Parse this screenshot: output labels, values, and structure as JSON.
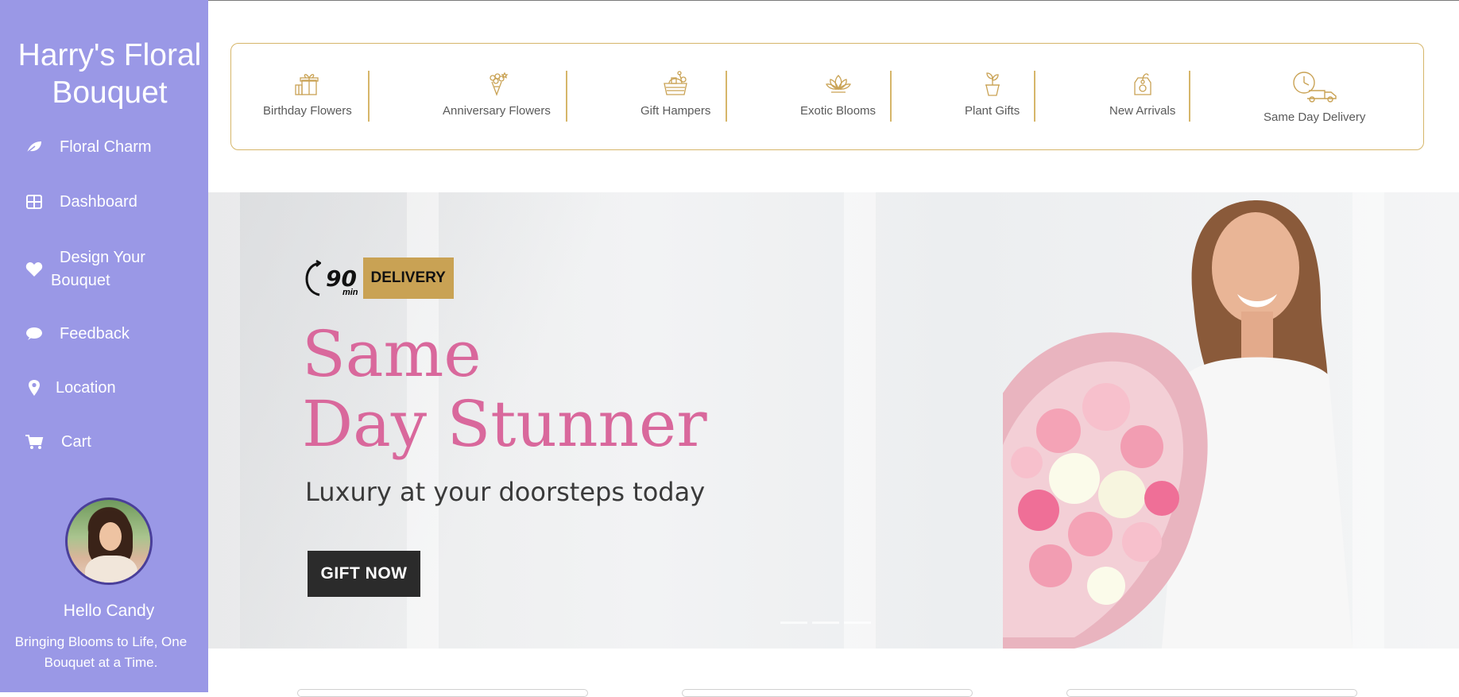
{
  "sidebar": {
    "brand": "Harry's Floral Bouquet",
    "items": [
      {
        "label": "Floral Charm",
        "icon": "leaf-icon"
      },
      {
        "label": "Dashboard",
        "icon": "grid-icon"
      },
      {
        "label": "Design Your Bouquet",
        "icon": "heart-icon"
      },
      {
        "label": "Feedback",
        "icon": "chat-bubble-icon"
      },
      {
        "label": "Location",
        "icon": "map-pin-icon"
      },
      {
        "label": "Cart",
        "icon": "shopping-cart-icon"
      }
    ],
    "greeting": "Hello Candy",
    "tagline": "Bringing Blooms to Life, One Bouquet at a Time."
  },
  "categories": [
    {
      "label": "Birthday Flowers",
      "icon": "gift-box-icon"
    },
    {
      "label": "Anniversary Flowers",
      "icon": "flower-bouquet-icon"
    },
    {
      "label": "Gift Hampers",
      "icon": "hamper-basket-icon"
    },
    {
      "label": "Exotic Blooms",
      "icon": "lotus-icon"
    },
    {
      "label": "Plant Gifts",
      "icon": "potted-plant-icon"
    },
    {
      "label": "New Arrivals",
      "icon": "tag-icon"
    },
    {
      "label": "Same Day Delivery",
      "icon": "delivery-truck-icon"
    }
  ],
  "hero": {
    "badge_number": "90",
    "badge_unit": "min",
    "badge_text": "DELIVERY",
    "headline_line1": "Same",
    "headline_line2": "Day Stunner",
    "subline": "Luxury at your doorsteps today",
    "cta": "GIFT NOW"
  },
  "colors": {
    "sidebar": "#9a98e6",
    "accent_gold": "#d6b66a",
    "headline_pink": "#d9689c"
  }
}
